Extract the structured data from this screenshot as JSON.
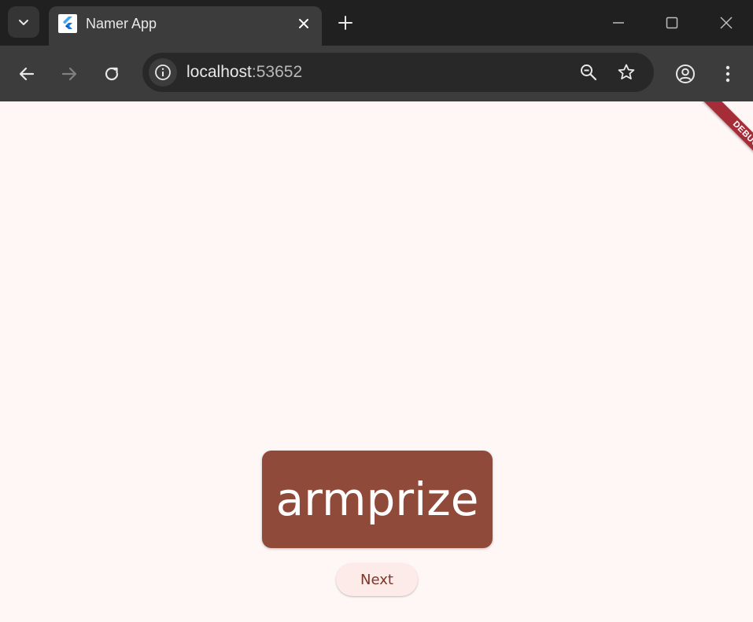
{
  "browser": {
    "tab": {
      "title": "Namer App",
      "favicon": "flutter-logo"
    },
    "address": {
      "host": "localhost",
      "port": ":53652"
    },
    "icons": [
      "chevron-down-icon",
      "close-icon",
      "plus-icon",
      "minimize-icon",
      "maximize-icon",
      "close-window-icon",
      "back-arrow-icon",
      "forward-arrow-icon",
      "reload-icon",
      "info-icon",
      "zoom-out-icon",
      "star-icon",
      "profile-icon",
      "menu-dots-icon"
    ]
  },
  "app": {
    "debug_banner": "DEBUG",
    "word": "armprize",
    "next_label": "Next",
    "colors": {
      "background": "#fff7f5",
      "card": "#904a3a",
      "button": "#fcebe8",
      "button_text": "#7a3628",
      "debug": "#a42d38"
    }
  }
}
